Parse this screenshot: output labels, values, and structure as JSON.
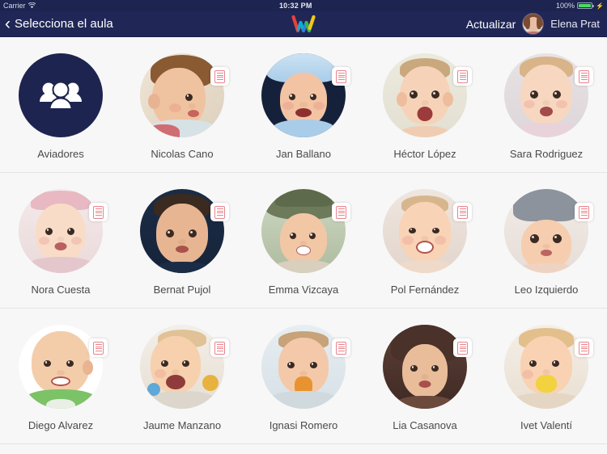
{
  "status_bar": {
    "carrier": "Carrier",
    "wifi_icon": "wifi-icon",
    "time": "10:32 PM",
    "battery_percent": "100%",
    "battery_icon": "battery-full-charging-icon"
  },
  "nav_bar": {
    "back_icon": "chevron-left-icon",
    "back_label": "Selecciona el aula",
    "logo_icon": "w-logo-icon",
    "refresh_label": "Actualizar",
    "user_avatar_icon": "user-avatar",
    "user_name": "Elena Prat",
    "background_color": "#202756"
  },
  "grid": {
    "rows": [
      {
        "cells": [
          {
            "label": "Aviadores",
            "type": "group",
            "icon": "group-people-icon",
            "has_badge": false
          },
          {
            "label": "Nicolas Cano",
            "type": "child",
            "has_badge": true,
            "badge_icon": "report-document-icon"
          },
          {
            "label": "Jan Ballano",
            "type": "child",
            "has_badge": true,
            "badge_icon": "report-document-icon"
          },
          {
            "label": "Héctor López",
            "type": "child",
            "has_badge": true,
            "badge_icon": "report-document-icon"
          },
          {
            "label": "Sara Rodriguez",
            "type": "child",
            "has_badge": true,
            "badge_icon": "report-document-icon"
          }
        ]
      },
      {
        "cells": [
          {
            "label": "Nora Cuesta",
            "type": "child",
            "has_badge": true,
            "badge_icon": "report-document-icon"
          },
          {
            "label": "Bernat Pujol",
            "type": "child",
            "has_badge": true,
            "badge_icon": "report-document-icon"
          },
          {
            "label": "Emma Vizcaya",
            "type": "child",
            "has_badge": true,
            "badge_icon": "report-document-icon"
          },
          {
            "label": "Pol Fernández",
            "type": "child",
            "has_badge": true,
            "badge_icon": "report-document-icon"
          },
          {
            "label": "Leo Izquierdo",
            "type": "child",
            "has_badge": true,
            "badge_icon": "report-document-icon"
          }
        ]
      },
      {
        "cells": [
          {
            "label": "Diego Alvarez",
            "type": "child",
            "has_badge": true,
            "badge_icon": "report-document-icon"
          },
          {
            "label": "Jaume Manzano",
            "type": "child",
            "has_badge": true,
            "badge_icon": "report-document-icon"
          },
          {
            "label": "Ignasi Romero",
            "type": "child",
            "has_badge": true,
            "badge_icon": "report-document-icon"
          },
          {
            "label": "Lia Casanova",
            "type": "child",
            "has_badge": true,
            "badge_icon": "report-document-icon"
          },
          {
            "label": "Ivet Valentí",
            "type": "child",
            "has_badge": true,
            "badge_icon": "report-document-icon"
          }
        ]
      }
    ]
  },
  "colors": {
    "navy": "#202756",
    "group_circle": "#1d2450",
    "content_bg": "#f7f7f7",
    "badge_accent": "#e8848c",
    "label_text": "#4a4a4a",
    "battery_green": "#4cd964"
  }
}
